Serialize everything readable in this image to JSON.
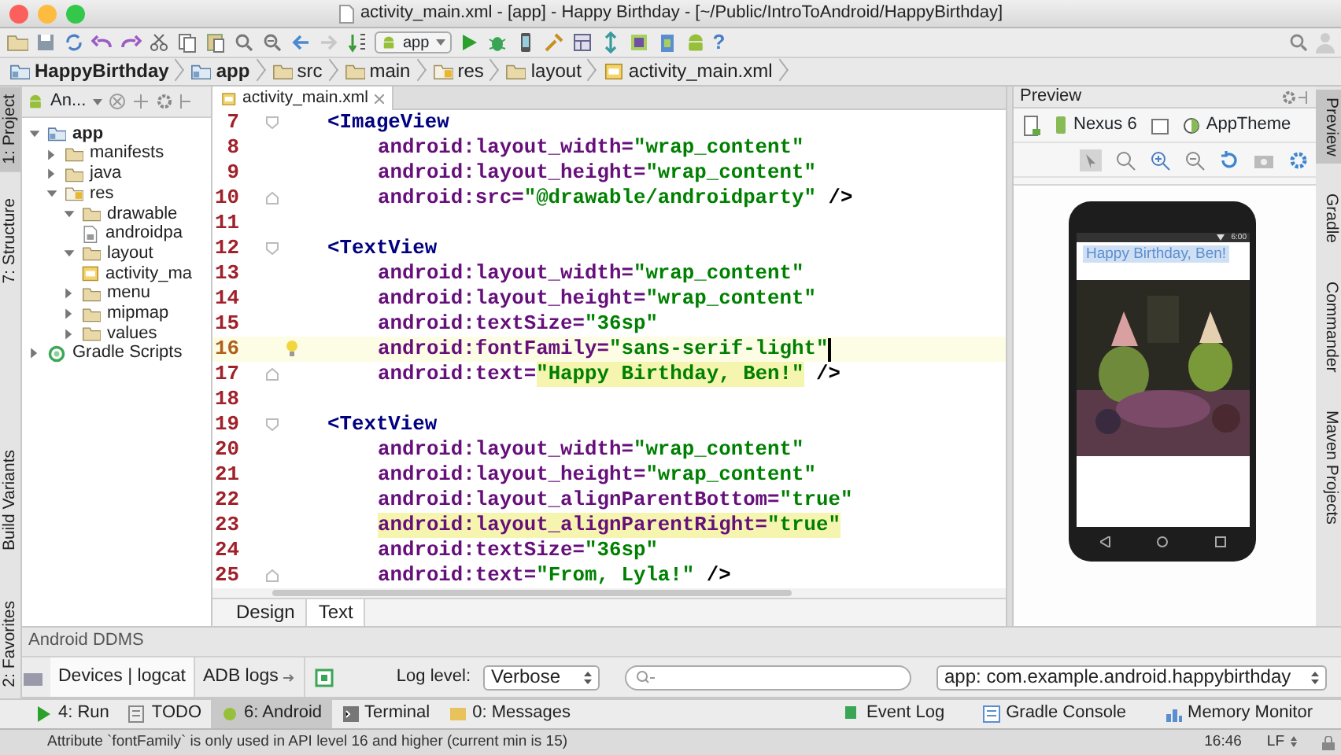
{
  "window": {
    "title": "activity_main.xml - [app] - Happy Birthday - [~/Public/IntroToAndroid/HappyBirthday]"
  },
  "toolbar": {
    "run_config": "app",
    "help": "?"
  },
  "breadcrumbs": [
    {
      "label": "HappyBirthday",
      "kind": "project"
    },
    {
      "label": "app",
      "kind": "module"
    },
    {
      "label": "src",
      "kind": "folder"
    },
    {
      "label": "main",
      "kind": "folder"
    },
    {
      "label": "res",
      "kind": "res_folder"
    },
    {
      "label": "layout",
      "kind": "folder"
    },
    {
      "label": "activity_main.xml",
      "kind": "layout_file"
    }
  ],
  "left_tool_strip": [
    {
      "label": "1: Project",
      "selected": true
    },
    {
      "label": "7: Structure",
      "selected": false
    },
    {
      "label": "Build Variants",
      "selected": false
    },
    {
      "label": "2: Favorites",
      "selected": false
    }
  ],
  "project_panel": {
    "view": "An...",
    "tree": [
      {
        "label": "app",
        "kind": "module",
        "expanded": true,
        "children": [
          {
            "label": "manifests",
            "kind": "folder",
            "expanded": false
          },
          {
            "label": "java",
            "kind": "folder",
            "expanded": false
          },
          {
            "label": "res",
            "kind": "res_folder",
            "expanded": true,
            "children": [
              {
                "label": "drawable",
                "kind": "folder",
                "expanded": true,
                "children": [
                  {
                    "label": "androidpa",
                    "kind": "image_file"
                  }
                ]
              },
              {
                "label": "layout",
                "kind": "folder",
                "expanded": true,
                "children": [
                  {
                    "label": "activity_ma",
                    "kind": "layout_file"
                  }
                ]
              },
              {
                "label": "menu",
                "kind": "folder",
                "expanded": false
              },
              {
                "label": "mipmap",
                "kind": "folder",
                "expanded": false
              },
              {
                "label": "values",
                "kind": "folder",
                "expanded": false
              }
            ]
          }
        ]
      },
      {
        "label": "Gradle Scripts",
        "kind": "gradle",
        "expanded": false
      }
    ]
  },
  "editor": {
    "tab": {
      "label": "activity_main.xml",
      "selected": true
    },
    "lines": [
      {
        "n": "7",
        "fold": {
          "kind": "open"
        },
        "current": false,
        "tokens": [
          {
            "kind": "tag",
            "text": "<ImageView"
          }
        ]
      },
      {
        "n": "8",
        "current": false,
        "tokens": [
          {
            "kind": "attr",
            "text": "android:layout_width="
          },
          {
            "kind": "value",
            "text": "\"wrap_content\""
          }
        ]
      },
      {
        "n": "9",
        "current": false,
        "tokens": [
          {
            "kind": "attr",
            "text": "android:layout_height="
          },
          {
            "kind": "value",
            "text": "\"wrap_content\""
          }
        ]
      },
      {
        "n": "10",
        "fold": {
          "kind": "close"
        },
        "current": false,
        "tokens": [
          {
            "kind": "attr",
            "text": "android:src="
          },
          {
            "kind": "value",
            "text": "\"@drawable/androidparty\""
          },
          {
            "kind": "plain",
            "text": " />"
          }
        ]
      },
      {
        "n": "11",
        "current": false
      },
      {
        "n": "12",
        "fold": {
          "kind": "open"
        },
        "current": false,
        "tokens": [
          {
            "kind": "tag",
            "text": "<TextView"
          }
        ]
      },
      {
        "n": "13",
        "current": false,
        "tokens": [
          {
            "kind": "attr",
            "text": "android:layout_width="
          },
          {
            "kind": "value",
            "text": "\"wrap_content\""
          }
        ]
      },
      {
        "n": "14",
        "current": false,
        "tokens": [
          {
            "kind": "attr",
            "text": "android:layout_height="
          },
          {
            "kind": "value",
            "text": "\"wrap_content\""
          }
        ]
      },
      {
        "n": "15",
        "current": false,
        "tokens": [
          {
            "kind": "attr",
            "text": "android:textSize="
          },
          {
            "kind": "value",
            "text": "\"36sp\""
          }
        ]
      },
      {
        "n": "16",
        "current": true,
        "tokens": [
          {
            "kind": "attr",
            "text": "android:fontFamily="
          },
          {
            "kind": "value",
            "text": "\"sans-serif-light\""
          }
        ]
      },
      {
        "n": "17",
        "fold": {
          "kind": "close"
        },
        "current": false,
        "tokens": [
          {
            "kind": "attr",
            "text": "android:text="
          },
          {
            "kind": "value",
            "text": "\"Happy Birthday, Ben!\"",
            "highlighted": true
          },
          {
            "kind": "plain",
            "text": " />"
          }
        ]
      },
      {
        "n": "18",
        "current": false
      },
      {
        "n": "19",
        "fold": {
          "kind": "open"
        },
        "current": false,
        "tokens": [
          {
            "kind": "tag",
            "text": "<TextView"
          }
        ]
      },
      {
        "n": "20",
        "current": false,
        "tokens": [
          {
            "kind": "attr",
            "text": "android:layout_width="
          },
          {
            "kind": "value",
            "text": "\"wrap_content\""
          }
        ]
      },
      {
        "n": "21",
        "current": false,
        "tokens": [
          {
            "kind": "attr",
            "text": "android:layout_height="
          },
          {
            "kind": "value",
            "text": "\"wrap_content\""
          }
        ]
      },
      {
        "n": "22",
        "current": false,
        "tokens": [
          {
            "kind": "attr",
            "text": "android:layout_alignParentBottom="
          },
          {
            "kind": "value",
            "text": "\"true\""
          }
        ]
      },
      {
        "n": "23",
        "current": false,
        "tokens": [
          {
            "kind": "attr",
            "text": "android:layout_alignParentRight=",
            "highlighted": true
          },
          {
            "kind": "value",
            "text": "\"true\"",
            "highlighted": true
          }
        ]
      },
      {
        "n": "24",
        "current": false,
        "tokens": [
          {
            "kind": "attr",
            "text": "android:textSize="
          },
          {
            "kind": "value",
            "text": "\"36sp\""
          }
        ]
      },
      {
        "n": "25",
        "fold": {
          "kind": "close"
        },
        "current": false,
        "tokens": [
          {
            "kind": "attr",
            "text": "android:text="
          },
          {
            "kind": "value",
            "text": "\"From, Lyla!\""
          },
          {
            "kind": "plain",
            "text": " />"
          }
        ]
      }
    ],
    "bottom_tabs": [
      {
        "label": "Design",
        "selected": false
      },
      {
        "label": "Text",
        "selected": true
      }
    ]
  },
  "preview": {
    "title": "Preview",
    "device": "Nexus 6",
    "theme": "AppTheme",
    "status_time": "6:00",
    "phone_text": "Happy Birthday, Ben!"
  },
  "right_tool_strip": [
    {
      "label": "Preview",
      "selected": true
    },
    {
      "label": "Gradle",
      "selected": false
    },
    {
      "label": "Commander",
      "selected": false
    },
    {
      "label": "Maven Projects",
      "selected": false
    }
  ],
  "ddms": {
    "title": "Android DDMS",
    "tabs": [
      {
        "label": "Devices | logcat",
        "selected": true
      },
      {
        "label": "ADB logs",
        "selected": false
      }
    ],
    "log_level_label": "Log level:",
    "log_level": "Verbose",
    "app_filter": "app: com.example.android.happybirthday"
  },
  "tool_tabs": [
    {
      "label": "4: Run",
      "kind": "run",
      "selected": false
    },
    {
      "label": "TODO",
      "kind": "todo",
      "selected": false
    },
    {
      "label": "6: Android",
      "kind": "android",
      "selected": true
    },
    {
      "label": "Terminal",
      "kind": "terminal",
      "selected": false
    },
    {
      "label": "0: Messages",
      "kind": "messages",
      "selected": false
    }
  ],
  "right_tool_tabs": [
    {
      "label": "Event Log",
      "kind": "log"
    },
    {
      "label": "Gradle Console",
      "kind": "console"
    },
    {
      "label": "Memory Monitor",
      "kind": "monitor"
    }
  ],
  "status_bar": {
    "message": "Attribute `fontFamily` is only used in API level 16 and higher (current min is 15)",
    "position": "16:46",
    "line_separator": "LF"
  }
}
